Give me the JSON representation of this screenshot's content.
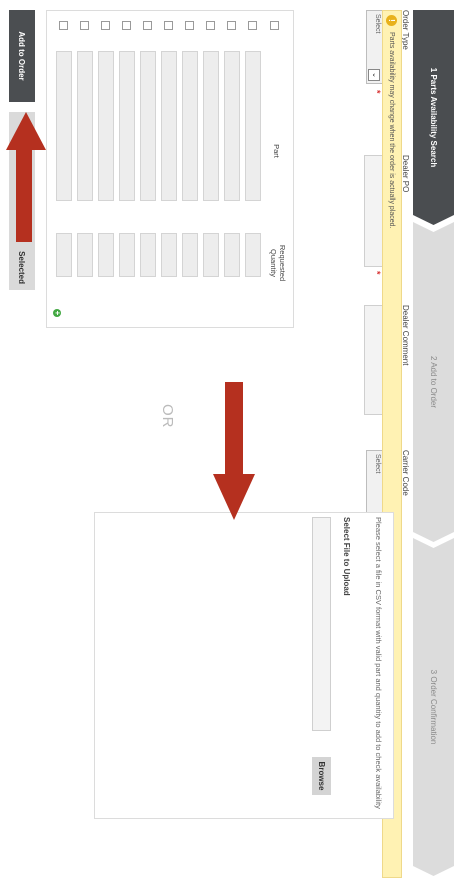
{
  "steps": [
    {
      "label": "1 Parts Availability Search",
      "active": true
    },
    {
      "label": "2  Add to Order",
      "active": false
    },
    {
      "label": "3  Order Confirmation",
      "active": false
    }
  ],
  "notice": {
    "text": "Parts availability may change when the order is actually placed."
  },
  "form": {
    "order_type": {
      "label": "Order Type",
      "value": "Select"
    },
    "dealer_po": {
      "label": "Dealer PO",
      "value": ""
    },
    "dealer_comment": {
      "label": "Dealer Comment",
      "value": ""
    },
    "carrier_code": {
      "label": "Carrier Code",
      "value": "Select"
    }
  },
  "parts_table": {
    "columns": [
      "Part",
      "Requested Quantity"
    ],
    "rows": 10
  },
  "or_text": "OR",
  "upload": {
    "description": "Please select a file in CSV format with valid part and quantity to add to check availability",
    "select_label": "Select File to Upload",
    "browse_label": "Browse"
  },
  "actions": {
    "add_to_order": "Add to Order",
    "add_selected": "Selected"
  },
  "colors": {
    "arrow": "#b5301f",
    "active_step": "#4a4d50",
    "notice_bg": "#fff2b3",
    "required": "#d62b2b"
  }
}
